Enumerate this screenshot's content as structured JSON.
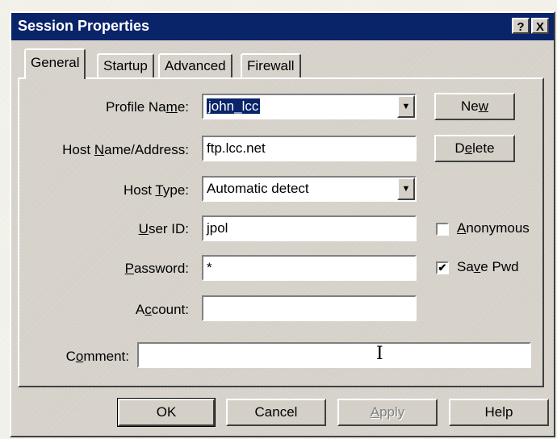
{
  "window": {
    "title": "Session Properties",
    "help_btn": "?",
    "close_btn": "X"
  },
  "tabs": [
    "General",
    "Startup",
    "Advanced",
    "Firewall"
  ],
  "form": {
    "profile_name": {
      "label_pre": "Profile Na",
      "label_u": "m",
      "label_post": "e:",
      "value": "john_lcc"
    },
    "host_name": {
      "label_pre": "Host ",
      "label_u": "N",
      "label_post": "ame/Address:",
      "value": "ftp.lcc.net"
    },
    "host_type": {
      "label_pre": "Host ",
      "label_u": "T",
      "label_post": "ype:",
      "value": "Automatic detect"
    },
    "user_id": {
      "label_pre": "",
      "label_u": "U",
      "label_post": "ser ID:",
      "value": "jpol"
    },
    "password": {
      "label_pre": "",
      "label_u": "P",
      "label_post": "assword:",
      "value": "*"
    },
    "account": {
      "label_pre": "A",
      "label_u": "c",
      "label_post": "count:",
      "value": ""
    },
    "comment": {
      "label_pre": "C",
      "label_u": "o",
      "label_post": "mment:",
      "value": ""
    }
  },
  "side_buttons": {
    "new": {
      "pre": "Ne",
      "u": "w",
      "post": ""
    },
    "delete": {
      "pre": "D",
      "u": "e",
      "post": "lete"
    }
  },
  "checkboxes": {
    "anonymous": {
      "pre": "",
      "u": "A",
      "post": "nonymous",
      "checked": false
    },
    "save_pwd": {
      "pre": "Sa",
      "u": "v",
      "post": "e Pwd",
      "checked": true,
      "mark": "✔"
    }
  },
  "footer": {
    "ok": "OK",
    "cancel": "Cancel",
    "apply": {
      "u": "A",
      "post": "pply"
    },
    "help": "Help"
  }
}
